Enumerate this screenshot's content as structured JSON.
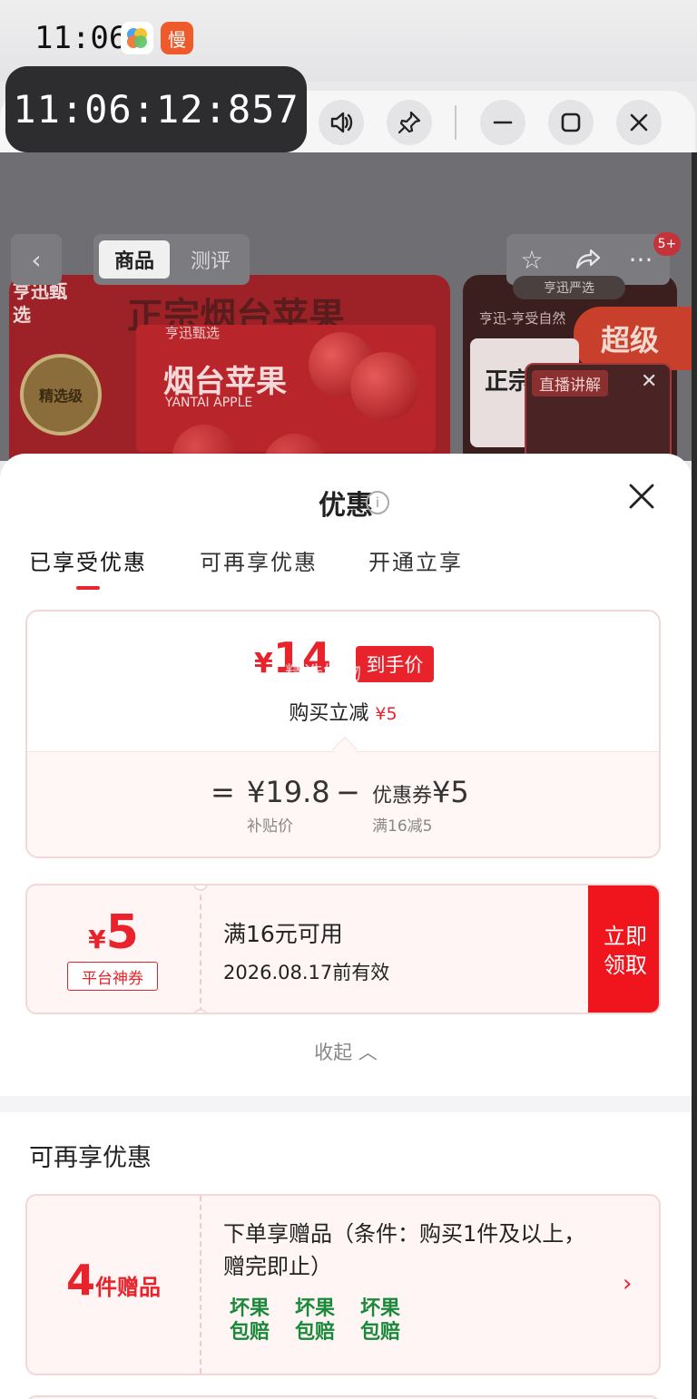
{
  "status_bar": {
    "time": "11:06",
    "app_badge": "慢"
  },
  "timer": "11:06:12:857",
  "window_controls": {
    "sound": "🔊",
    "pin": "📌",
    "minimize": "—",
    "maximize": "▢",
    "close": "✕"
  },
  "product_page": {
    "tabs": [
      "商品",
      "测评"
    ],
    "hero_title": "正宗烟台苹果",
    "brand_side": "亨迅甄选",
    "medal": "精选级",
    "box_title": "烟台苹果",
    "box_subtitle": "YANTAI APPLE",
    "box_brand": "亨迅甄选",
    "cart_badge": "5+",
    "store_pill": "亨迅严选",
    "hero2_badge": "超级",
    "hero2_text": "亨迅-亨受自然",
    "hero2_card_text": "正宗",
    "live_label": "直播讲解"
  },
  "sheet": {
    "title": "优惠",
    "tabs": [
      "已享受优惠",
      "可再享优惠",
      "开通立享"
    ],
    "active_tab_index": 0,
    "price": {
      "currency": "¥",
      "amount": "14",
      "tag": "到手价",
      "overlay_text": "精选好物",
      "discount_label": "购买立减",
      "discount_amount": "¥5",
      "equals": "=",
      "subsidy_price": "¥19.8",
      "subsidy_label": "补贴价",
      "minus": "−",
      "coupon_label": "优惠券",
      "coupon_value": "¥5",
      "coupon_rule": "满16减5"
    },
    "coupon": {
      "currency": "¥",
      "amount": "5",
      "kind": "平台神券",
      "condition": "满16元可用",
      "validity": "2026.08.17前有效",
      "claim_label": "立即领取"
    },
    "collapse_label": "收起 ︿",
    "section2_title": "可再享优惠",
    "gift": {
      "count": "4",
      "unit": "件赠品",
      "description": "下单享赠品（条件：购买1件及以上，赠完即止）",
      "tags": [
        "坏果包赔",
        "坏果包赔",
        "坏果包赔"
      ],
      "arrow": "›"
    }
  },
  "colors": {
    "accent_red": "#e8232b",
    "tag_green": "#1a8a3a"
  }
}
